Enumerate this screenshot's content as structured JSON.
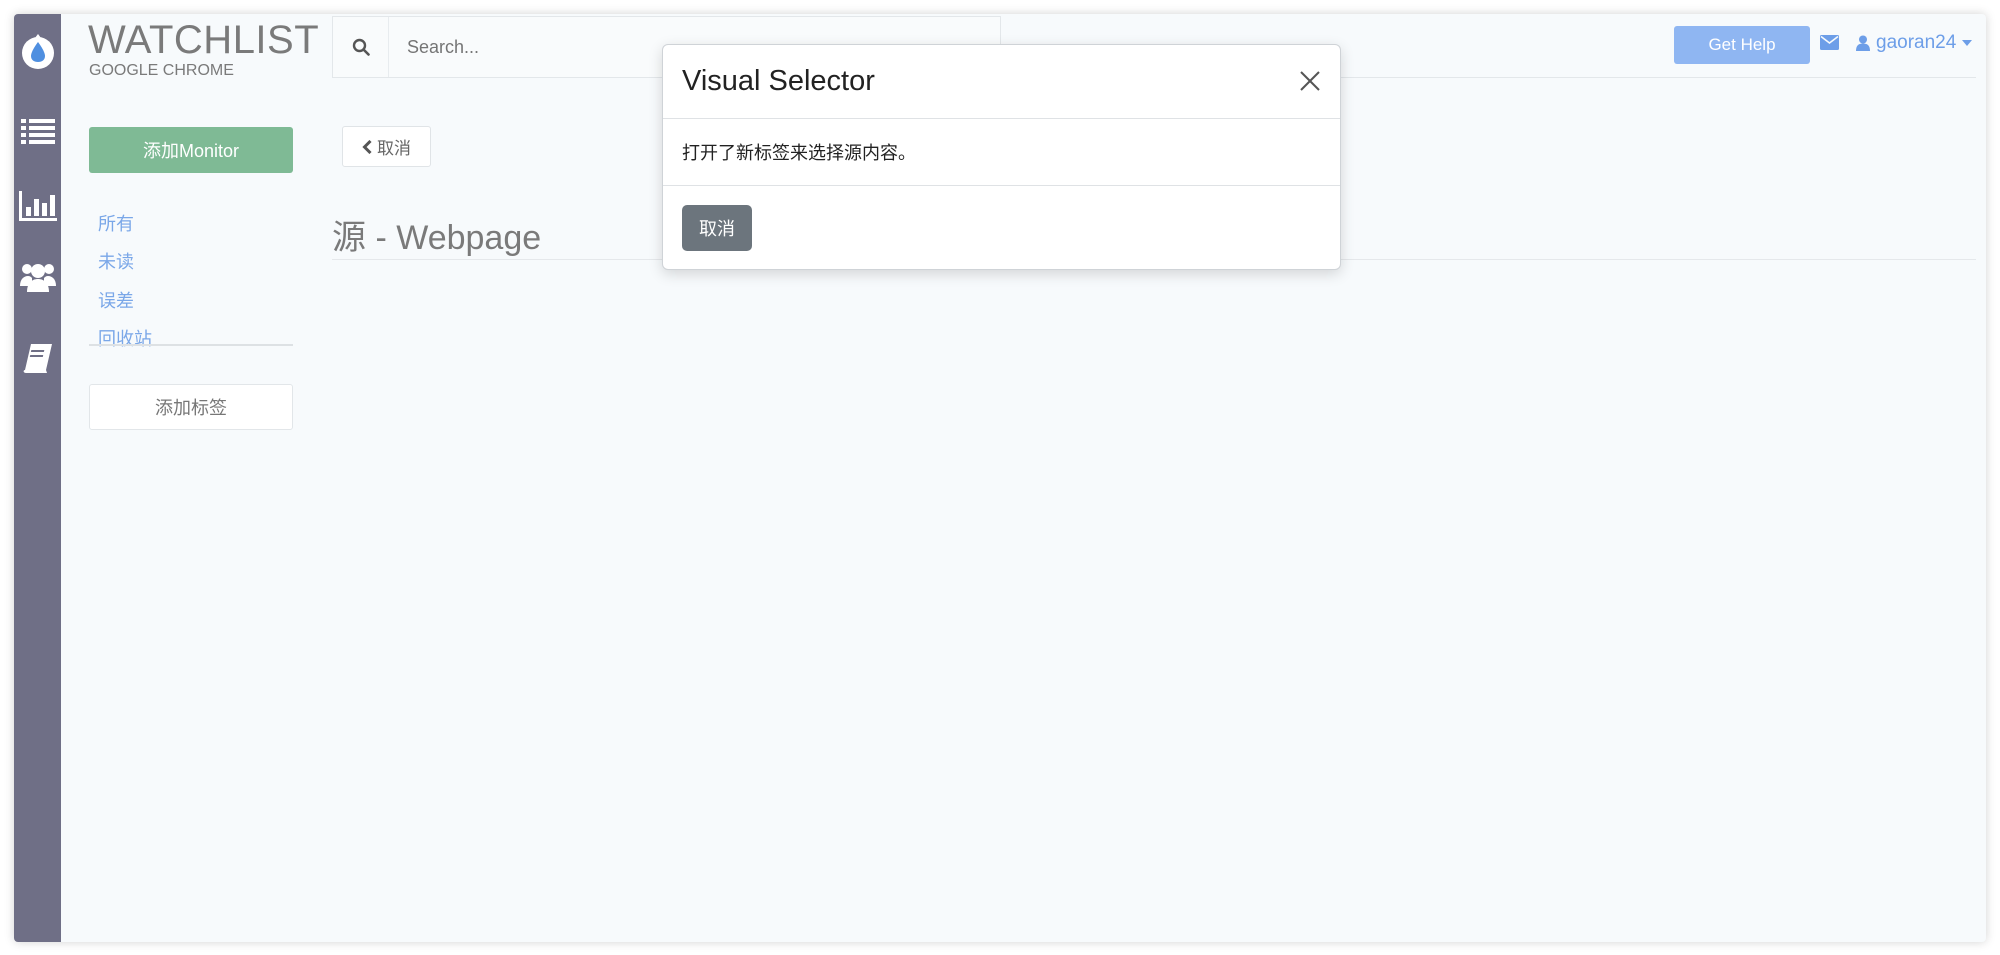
{
  "app": {
    "title": "WATCHLIST",
    "subtitle": "GOOGLE CHROME"
  },
  "rail": {
    "icons": [
      "logo-drop-icon",
      "list-icon",
      "chart-icon",
      "users-icon",
      "book-icon"
    ]
  },
  "search": {
    "placeholder": "Search..."
  },
  "header": {
    "help_label": "Get Help",
    "username": "gaoran24"
  },
  "sidebar": {
    "add_monitor_label": "添加Monitor",
    "links": [
      {
        "label": "所有"
      },
      {
        "label": "未读"
      },
      {
        "label": "误差"
      },
      {
        "label": "回收站"
      }
    ],
    "add_tag_label": "添加标签"
  },
  "main": {
    "back_label": "取消",
    "page_title": "源 - Webpage"
  },
  "modal": {
    "title": "Visual Selector",
    "message": "打开了新标签来选择源内容。",
    "cancel_label": "取消"
  },
  "colors": {
    "rail": "#6f6f86",
    "accent_green": "#7fba95",
    "link_blue": "#7aa7e8",
    "help_blue": "#8fb6f2",
    "cancel_gray": "#6c757d"
  }
}
